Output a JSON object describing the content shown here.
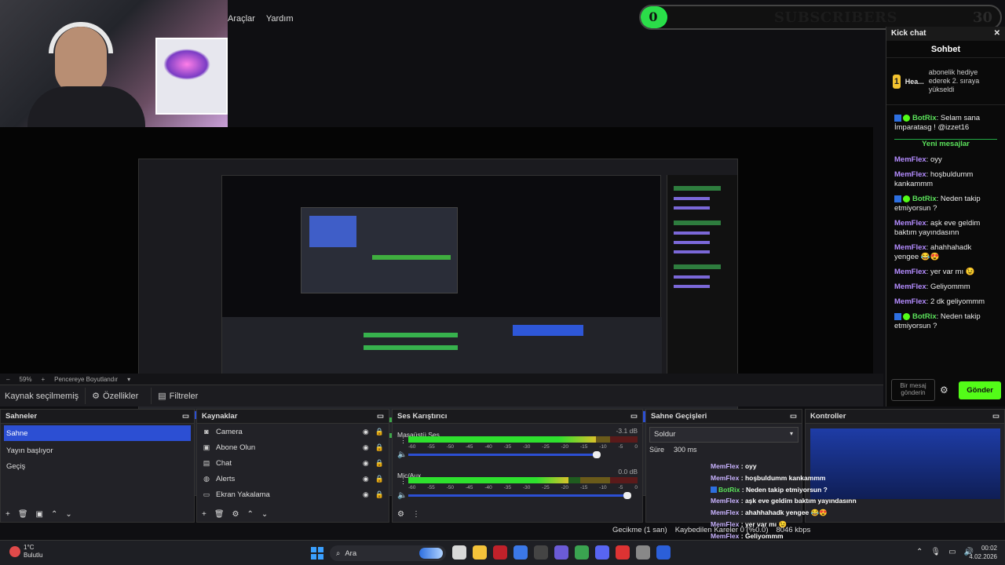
{
  "menu": [
    "Araçlar",
    "Yardım"
  ],
  "subscribers": {
    "count": "0",
    "label": "SUBSCRIBERS",
    "goal": "30"
  },
  "preview": {
    "zoom": "59%",
    "fit_label": "Pencereye Boyutlandır"
  },
  "source_toolbar": {
    "no_source": "Kaynak seçilmemiş",
    "properties": "Özellikler",
    "filters": "Filtreler"
  },
  "chat": {
    "title": "Kick chat",
    "tab": "Sohbet",
    "pinned": {
      "coin": "1",
      "user": "Hea...",
      "count": "1",
      "text": "abonelik hediye ederek 2. sıraya yükseldi"
    },
    "new_messages": "Yeni mesajlar",
    "messages": [
      {
        "user": "BotRix",
        "text": "Selam sana İmparatasg ! @izzet16",
        "bot": true
      },
      {
        "user": "MemFlex",
        "text": "oyy",
        "bot": false
      },
      {
        "user": "MemFlex",
        "text": "hoşbuldumm kankammm",
        "bot": false
      },
      {
        "user": "BotRix",
        "text": "Neden takip etmiyorsun ?",
        "bot": true
      },
      {
        "user": "MemFlex",
        "text": "aşk eve geldim baktım yayındasınn",
        "bot": false
      },
      {
        "user": "MemFlex",
        "text": "ahahhahadk yengee 😂😍",
        "bot": false
      },
      {
        "user": "MemFlex",
        "text": "yer var mı 😉",
        "bot": false
      },
      {
        "user": "MemFlex",
        "text": "Geliyommm",
        "bot": false
      },
      {
        "user": "MemFlex",
        "text": "2 dk geliyommm",
        "bot": false
      },
      {
        "user": "BotRix",
        "text": "Neden takip etmiyorsun ?",
        "bot": true
      }
    ],
    "input_placeholder": "Bir mesaj gönderin",
    "send_label": "Gönder"
  },
  "scenes": {
    "title": "Sahneler",
    "items": [
      "Sahne",
      "Yayın başlıyor",
      "Geçiş"
    ],
    "selected": 0
  },
  "sources": {
    "title": "Kaynaklar",
    "items": [
      {
        "name": "Camera",
        "icon": "camera-icon"
      },
      {
        "name": "Abone Olun",
        "icon": "image-icon"
      },
      {
        "name": "Chat",
        "icon": "chat-icon"
      },
      {
        "name": "Alerts",
        "icon": "globe-icon"
      },
      {
        "name": "Ekran Yakalama",
        "icon": "monitor-icon"
      }
    ]
  },
  "mixer": {
    "title": "Ses Karıştırıcı",
    "ticks": [
      "-60",
      "-55",
      "-50",
      "-45",
      "-40",
      "-35",
      "-30",
      "-25",
      "-20",
      "-15",
      "-10",
      "-5",
      "0"
    ],
    "channels": [
      {
        "name": "Masaüstü Ses",
        "db": "-3.1 dB",
        "level": 0.82,
        "volume": 0.86
      },
      {
        "name": "Mic/Aux",
        "db": "0.0 dB",
        "level": 0.7,
        "volume": 1.0
      }
    ]
  },
  "transitions": {
    "title": "Sahne Geçişleri",
    "selected": "Soldur",
    "duration_label": "Süre",
    "duration": "300 ms"
  },
  "controls": {
    "title": "Kontroller"
  },
  "overlay_chat": [
    {
      "user": "MemFlex",
      "text": "oyy",
      "bot": false
    },
    {
      "user": "MemFlex",
      "text": "hoşbuldumm kankammm",
      "bot": false
    },
    {
      "user": "BotRix",
      "text": "Neden takip etmiyorsun ?",
      "bot": true
    },
    {
      "user": "MemFlex",
      "text": "aşk eve geldim baktım yayındasınn",
      "bot": false
    },
    {
      "user": "MemFlex",
      "text": "ahahhahadk yengee 😂😍",
      "bot": false
    },
    {
      "user": "MemFlex",
      "text": "yer var mı 😉",
      "bot": false
    },
    {
      "user": "MemFlex",
      "text": "Geliyommm",
      "bot": false
    },
    {
      "user": "MemFlex",
      "text": "2 dk geliyommm",
      "bot": false
    },
    {
      "user": "BotRix",
      "text": "Neden takip etmiyorsun ?",
      "bot": true
    }
  ],
  "status": {
    "delay": "Gecikme (1 san)",
    "dropped": "Kaybedilen Kareler 0 (%0.0)",
    "bitrate": "8046 kbps"
  },
  "taskbar": {
    "temp": "1°C",
    "weather": "Bulutlu",
    "search": "Ara",
    "time": "00:02",
    "date": "4.02.2026"
  },
  "colors": {
    "accent": "#2c4fd3",
    "kick_green": "#53fc18",
    "background": "#0f0f12"
  }
}
